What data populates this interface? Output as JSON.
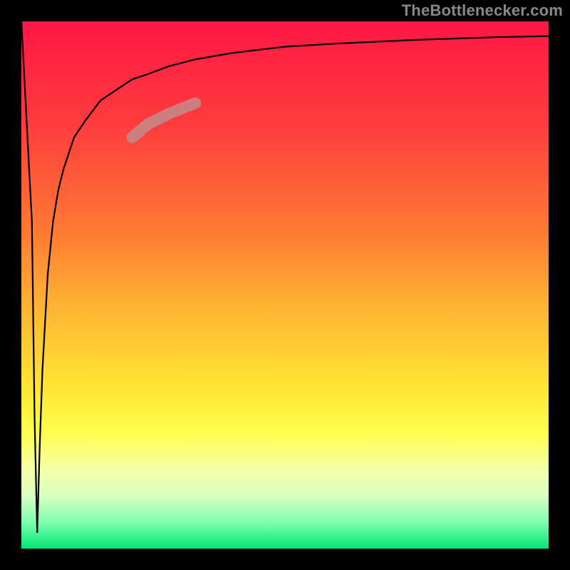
{
  "watermark": "TheBottlenecker.com",
  "chart_data": {
    "type": "line",
    "title": "",
    "xlabel": "",
    "ylabel": "",
    "xlim": [
      0,
      100
    ],
    "ylim": [
      0,
      100
    ],
    "grid": false,
    "series": [
      {
        "name": "bottleneck-curve",
        "x": [
          0,
          2.0,
          2.5,
          3.0,
          3.5,
          4,
          5,
          6,
          7,
          8,
          10,
          12,
          15,
          18,
          21,
          24,
          28,
          33,
          40,
          50,
          60,
          75,
          90,
          100
        ],
        "y": [
          100,
          62,
          25,
          3,
          20,
          34,
          52,
          62,
          68,
          72,
          78,
          81,
          85,
          87,
          89,
          90,
          91.5,
          92.8,
          94,
          95.2,
          95.8,
          96.5,
          97,
          97.2
        ]
      }
    ],
    "highlight_segment": {
      "x": [
        21,
        24,
        28,
        33
      ],
      "y": [
        78,
        80.5,
        82.5,
        84.5
      ]
    },
    "gradient_stops": [
      {
        "offset": 0.0,
        "color": "#ff1744"
      },
      {
        "offset": 0.2,
        "color": "#ff3d3d"
      },
      {
        "offset": 0.4,
        "color": "#ff7a33"
      },
      {
        "offset": 0.55,
        "color": "#ffb733"
      },
      {
        "offset": 0.7,
        "color": "#ffe733"
      },
      {
        "offset": 0.78,
        "color": "#ffff4d"
      },
      {
        "offset": 0.85,
        "color": "#f6ffa8"
      },
      {
        "offset": 0.9,
        "color": "#d9ffc2"
      },
      {
        "offset": 0.95,
        "color": "#7effb0"
      },
      {
        "offset": 1.0,
        "color": "#00e676"
      }
    ]
  }
}
